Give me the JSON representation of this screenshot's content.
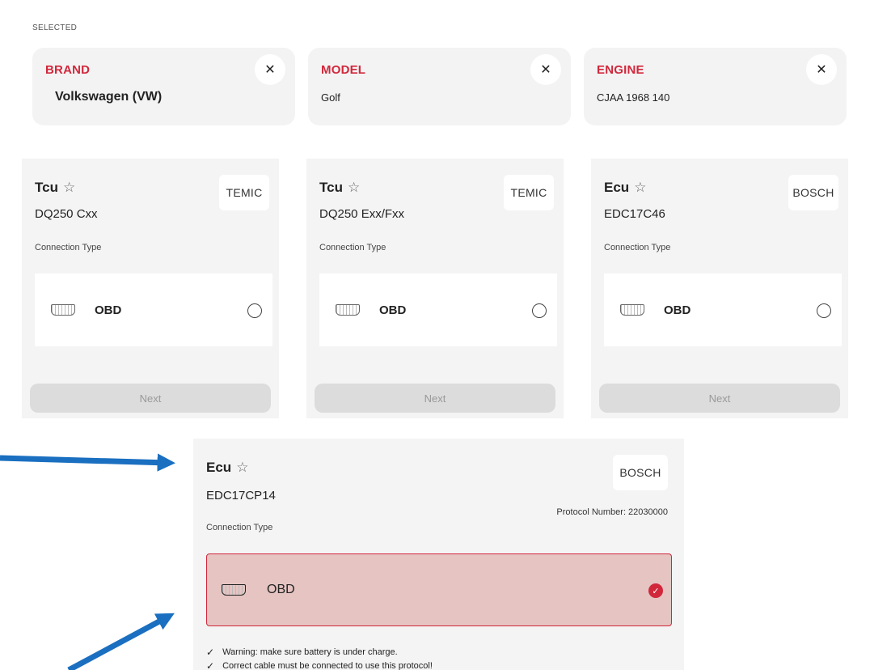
{
  "section_label": "SELECTED",
  "selected": [
    {
      "label": "BRAND",
      "value": "Volkswagen (VW)"
    },
    {
      "label": "MODEL",
      "value": "Golf"
    },
    {
      "label": "ENGINE",
      "value": "CJAA 1968 140"
    }
  ],
  "close_glyph": "✕",
  "star_glyph": "☆",
  "cards": [
    {
      "type": "Tcu",
      "model": "DQ250 Cxx",
      "brand": "TEMIC",
      "connection_label": "Connection Type",
      "connection": "OBD",
      "next_label": "Next"
    },
    {
      "type": "Tcu",
      "model": "DQ250 Exx/Fxx",
      "brand": "TEMIC",
      "connection_label": "Connection Type",
      "connection": "OBD",
      "next_label": "Next"
    },
    {
      "type": "Ecu",
      "model": "EDC17C46",
      "brand": "BOSCH",
      "connection_label": "Connection Type",
      "connection": "OBD",
      "next_label": "Next"
    }
  ],
  "selected_card": {
    "type": "Ecu",
    "model": "EDC17CP14",
    "brand": "BOSCH",
    "protocol": "Protocol Number: 22030000",
    "connection_label": "Connection Type",
    "connection": "OBD",
    "warnings": [
      "Warning: make sure battery is under charge.",
      "Correct cable must be connected to use this protocol!"
    ]
  },
  "colors": {
    "accent": "#d1273b",
    "card_bg": "#f4f4f4",
    "selected_bg": "#e5c4c2",
    "arrow": "#1a6fc0"
  },
  "icons": [
    "close-icon",
    "star-icon",
    "obd-connector-icon",
    "radio-icon",
    "check-circle-icon",
    "check-icon",
    "arrow-annotation"
  ]
}
